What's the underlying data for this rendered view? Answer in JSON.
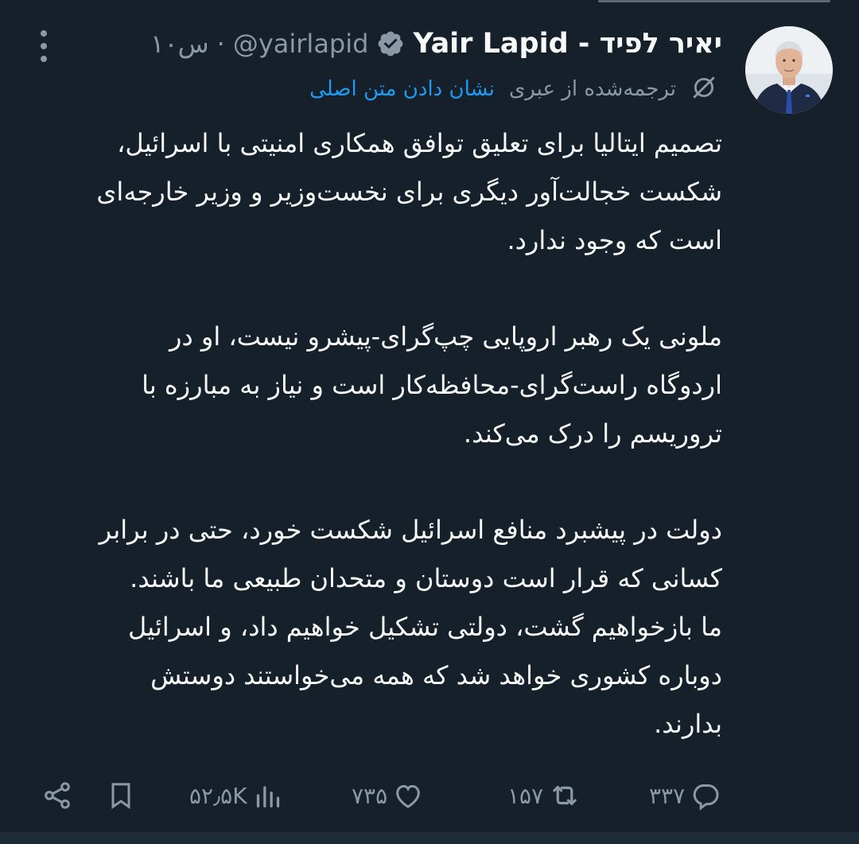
{
  "tweet": {
    "author_name": "Yair Lapid - יאיר לפיד",
    "handle": "@yairlapid",
    "separator": "·",
    "time": "۱۰س",
    "translated_label": "ترجمه‌شده از عبری",
    "show_original_link": "نشان دادن متن اصلی",
    "paragraphs": [
      "تصمیم ایتالیا برای تعلیق توافق همکاری امنیتی با اسرائیل،\nشکست خجالت‌آور دیگری برای نخست‌وزیر و وزیر خارجه‌ای\nاست که وجود ندارد.",
      "ملونی یک رهبر اروپایی چپ‌گرای-پیشرو نیست، او در\nاردوگاه راست‌گرای-محافظه‌کار است و نیاز به مبارزه با\nتروریسم را درک می‌کند.",
      "دولت در پیشبرد منافع اسرائیل شکست خورد، حتی در برابر\nکسانی که قرار است دوستان و متحدان طبیعی ما باشند.\nما بازخواهیم گشت، دولتی تشکیل خواهیم داد، و اسرائیل\nدوباره کشوری خواهد شد که همه می‌خواستند دوستش\nبدارند."
    ]
  },
  "actions": {
    "replies": "۳۳۷",
    "retweets": "۱۵۷",
    "likes": "۷۳۵",
    "views": "۵۲٫۵K"
  },
  "icons": {
    "more": "more-vertical-icon",
    "verified": "verified-badge-icon",
    "translate": "translate-icon",
    "reply": "reply-icon",
    "retweet": "retweet-icon",
    "like": "heart-icon",
    "views": "views-bar-chart-icon",
    "bookmark": "bookmark-icon",
    "share": "share-icon"
  },
  "colors": {
    "background": "#15202b",
    "text": "#f7f9f9",
    "muted": "#8b98a5",
    "link": "#1d9bf0"
  }
}
